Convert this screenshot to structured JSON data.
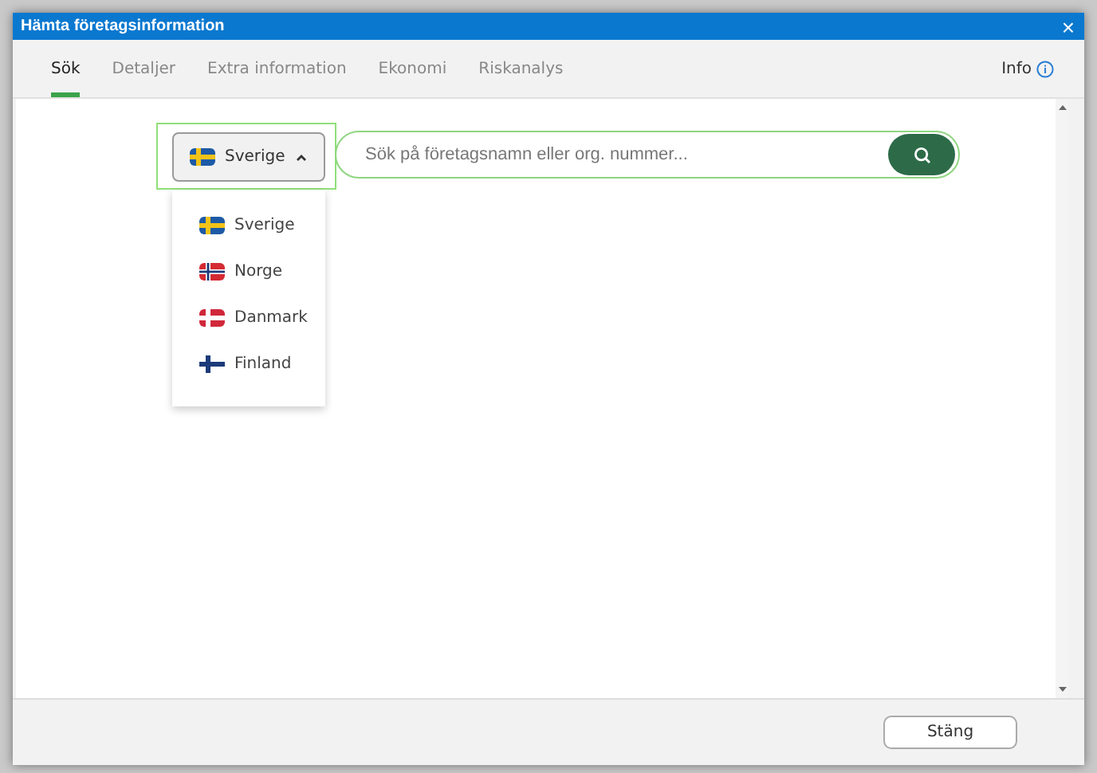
{
  "window": {
    "title": "Hämta företagsinformation",
    "close": "×"
  },
  "tabs": [
    {
      "label": "Sök",
      "selected": true
    },
    {
      "label": "Detaljer",
      "selected": false
    },
    {
      "label": "Extra information",
      "selected": false
    },
    {
      "label": "Ekonomi",
      "selected": false
    },
    {
      "label": "Riskanalys",
      "selected": false
    }
  ],
  "info_link": "Info",
  "country_select": {
    "value": "Sverige",
    "kind": "se",
    "expanded": true
  },
  "countries": [
    {
      "label": "Sverige",
      "kind": "se"
    },
    {
      "label": "Norge",
      "kind": "no"
    },
    {
      "label": "Danmark",
      "kind": "dk"
    },
    {
      "label": "Finland",
      "kind": "fi"
    }
  ],
  "search": {
    "placeholder": "Sök på företagsnamn eller org. nummer..."
  },
  "buttons": [
    "Stäng"
  ]
}
